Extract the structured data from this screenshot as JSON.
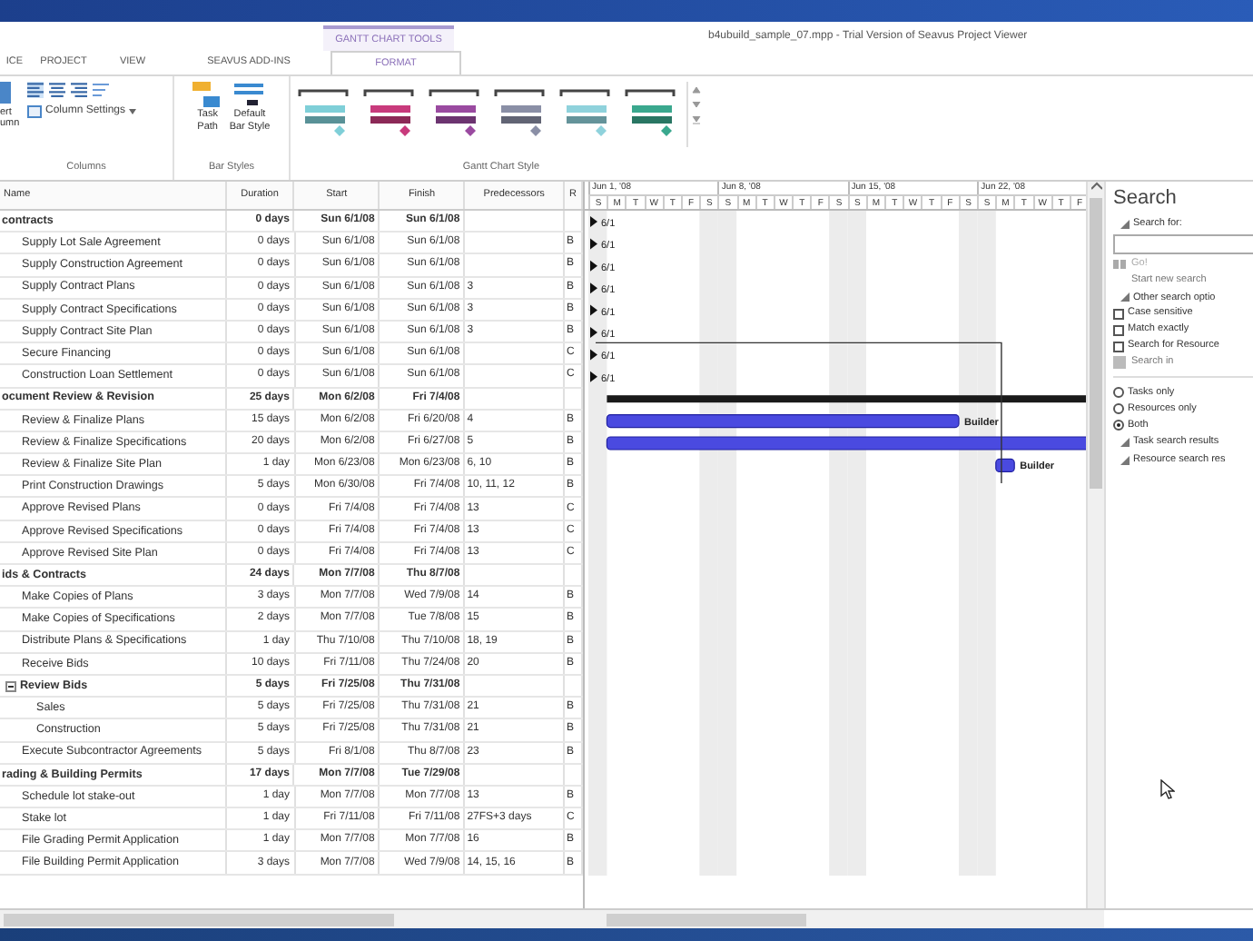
{
  "window": {
    "title": "b4ubuild_sample_07.mpp - Trial Version of Seavus Project Viewer",
    "tool_group": "GANTT CHART TOOLS"
  },
  "ribbon_tabs": [
    {
      "label": "ICE",
      "selected": false
    },
    {
      "label": "PROJECT",
      "selected": false
    },
    {
      "label": "VIEW",
      "selected": false
    },
    {
      "label": "SEAVUS ADD-INS",
      "selected": false
    },
    {
      "label": "FORMAT",
      "selected": true
    }
  ],
  "columns_group": {
    "title": "Columns",
    "insert_lines": [
      "ert",
      "umn"
    ],
    "settings": "Column Settings"
  },
  "bar_styles_group": {
    "title": "Bar Styles",
    "task_path": [
      "Task",
      "Path"
    ],
    "default_style": [
      "Default",
      "Bar Style"
    ]
  },
  "gantt_style_group": {
    "title": "Gantt Chart Style",
    "styles": [
      {
        "color": "#7fcfd8"
      },
      {
        "color": "#c83a7c"
      },
      {
        "color": "#9a4aa0"
      },
      {
        "color": "#8a8fa6"
      },
      {
        "color": "#8fd2dc"
      },
      {
        "color": "#3aa88e"
      }
    ]
  },
  "table": {
    "columns": [
      "Name",
      "Duration",
      "Start",
      "Finish",
      "Predecessors",
      "R"
    ],
    "tasks": [
      {
        "kind": "summary_milestone",
        "name": "contracts",
        "duration": "0 days",
        "start": "Sun 6/1/08",
        "finish": "Sun 6/1/08",
        "bar_label": "6/1",
        "children": [
          {
            "kind": "milestone",
            "name": "Supply Lot Sale Agreement",
            "duration": "0 days",
            "start": "Sun 6/1/08",
            "finish": "Sun 6/1/08",
            "resource": "B",
            "bar_label": "6/1"
          },
          {
            "kind": "milestone",
            "name": "Supply Construction Agreement",
            "duration": "0 days",
            "start": "Sun 6/1/08",
            "finish": "Sun 6/1/08",
            "resource": "B",
            "bar_label": "6/1"
          },
          {
            "kind": "milestone",
            "name": "Supply Contract Plans",
            "duration": "0 days",
            "start": "Sun 6/1/08",
            "finish": "Sun 6/1/08",
            "predecessors": "3",
            "resource": "B",
            "bar_label": "6/1"
          },
          {
            "kind": "milestone",
            "name": "Supply Contract Specifications",
            "duration": "0 days",
            "start": "Sun 6/1/08",
            "finish": "Sun 6/1/08",
            "predecessors": "3",
            "resource": "B",
            "bar_label": "6/1"
          },
          {
            "kind": "milestone",
            "name": "Supply Contract Site Plan",
            "duration": "0 days",
            "start": "Sun 6/1/08",
            "finish": "Sun 6/1/08",
            "predecessors": "3",
            "resource": "B",
            "bar_label": "6/1"
          },
          {
            "kind": "milestone",
            "name": "Secure Financing",
            "duration": "0 days",
            "start": "Sun 6/1/08",
            "finish": "Sun 6/1/08",
            "resource": "C",
            "bar_label": "6/1"
          },
          {
            "kind": "milestone",
            "name": "Construction Loan Settlement",
            "duration": "0 days",
            "start": "Sun 6/1/08",
            "finish": "Sun 6/1/08",
            "resource": "C",
            "bar_label": "6/1"
          }
        ]
      },
      {
        "kind": "summary",
        "name": "ocument Review & Revision",
        "duration": "25 days",
        "start": "Mon 6/2/08",
        "finish": "Fri 7/4/08",
        "children": [
          {
            "kind": "task",
            "name": "Review & Finalize Plans",
            "duration": "15 days",
            "start": "Mon 6/2/08",
            "finish": "Fri 6/20/08",
            "predecessors": "4",
            "resource": "B",
            "bar_label": "Builder"
          },
          {
            "kind": "task",
            "name": "Review & Finalize Specifications",
            "duration": "20 days",
            "start": "Mon 6/2/08",
            "finish": "Fri 6/27/08",
            "predecessors": "5",
            "resource": "B"
          },
          {
            "kind": "task",
            "name": "Review & Finalize Site Plan",
            "duration": "1 day",
            "start": "Mon 6/23/08",
            "finish": "Mon 6/23/08",
            "predecessors": "6, 10",
            "resource": "B",
            "bar_label": "Builder"
          },
          {
            "kind": "task",
            "name": "Print Construction Drawings",
            "duration": "5 days",
            "start": "Mon 6/30/08",
            "finish": "Fri 7/4/08",
            "predecessors": "10, 11, 12",
            "resource": "B"
          },
          {
            "kind": "milestone",
            "name": "Approve Revised Plans",
            "duration": "0 days",
            "start": "Fri 7/4/08",
            "finish": "Fri 7/4/08",
            "predecessors": "13",
            "resource": "C"
          },
          {
            "kind": "milestone",
            "name": "Approve Revised Specifications",
            "duration": "0 days",
            "start": "Fri 7/4/08",
            "finish": "Fri 7/4/08",
            "predecessors": "13",
            "resource": "C"
          },
          {
            "kind": "milestone",
            "name": "Approve Revised Site Plan",
            "duration": "0 days",
            "start": "Fri 7/4/08",
            "finish": "Fri 7/4/08",
            "predecessors": "13",
            "resource": "C"
          }
        ]
      },
      {
        "kind": "summary",
        "name": "ids & Contracts",
        "duration": "24 days",
        "start": "Mon 7/7/08",
        "finish": "Thu 8/7/08",
        "children": [
          {
            "kind": "task",
            "name": "Make Copies of Plans",
            "duration": "3 days",
            "start": "Mon 7/7/08",
            "finish": "Wed 7/9/08",
            "predecessors": "14",
            "resource": "B"
          },
          {
            "kind": "task",
            "name": "Make Copies of Specifications",
            "duration": "2 days",
            "start": "Mon 7/7/08",
            "finish": "Tue 7/8/08",
            "predecessors": "15",
            "resource": "B"
          },
          {
            "kind": "task",
            "name": "Distribute Plans & Specifications",
            "duration": "1 day",
            "start": "Thu 7/10/08",
            "finish": "Thu 7/10/08",
            "predecessors": "18, 19",
            "resource": "B"
          },
          {
            "kind": "task",
            "name": "Receive Bids",
            "duration": "10 days",
            "start": "Fri 7/11/08",
            "finish": "Thu 7/24/08",
            "predecessors": "20",
            "resource": "B"
          },
          {
            "kind": "summary",
            "name": "Review Bids",
            "duration": "5 days",
            "start": "Fri 7/25/08",
            "finish": "Thu 7/31/08",
            "expanded": true,
            "children": [
              {
                "name": "Sales",
                "duration": "5 days",
                "start": "Fri 7/25/08",
                "finish": "Thu 7/31/08",
                "predecessors": "21",
                "resource": "B"
              },
              {
                "name": "Construction",
                "duration": "5 days",
                "start": "Fri 7/25/08",
                "finish": "Thu 7/31/08",
                "predecessors": "21",
                "resource": "B"
              }
            ]
          },
          {
            "kind": "task",
            "name": "Execute Subcontractor Agreements",
            "duration": "5 days",
            "start": "Fri 8/1/08",
            "finish": "Thu 8/7/08",
            "predecessors": "23",
            "resource": "B"
          }
        ]
      },
      {
        "kind": "summary",
        "name": "rading & Building Permits",
        "duration": "17 days",
        "start": "Mon 7/7/08",
        "finish": "Tue 7/29/08",
        "children": [
          {
            "kind": "task",
            "name": "Schedule lot stake-out",
            "duration": "1 day",
            "start": "Mon 7/7/08",
            "finish": "Mon 7/7/08",
            "predecessors": "13",
            "resource": "B"
          },
          {
            "kind": "task",
            "name": "Stake lot",
            "duration": "1 day",
            "start": "Fri 7/11/08",
            "finish": "Fri 7/11/08",
            "predecessors": "27FS+3 days",
            "resource": "C"
          },
          {
            "kind": "task",
            "name": "File Grading Permit Application",
            "duration": "1 day",
            "start": "Mon 7/7/08",
            "finish": "Mon 7/7/08",
            "predecessors": "16",
            "resource": "B"
          },
          {
            "kind": "task",
            "name": "File Building Permit Application",
            "duration": "3 days",
            "start": "Mon 7/7/08",
            "finish": "Wed 7/9/08",
            "predecessors": "14, 15, 16",
            "resource": "B"
          }
        ]
      }
    ]
  },
  "gantt": {
    "weeks": [
      {
        "label": "Jun 1, '08",
        "days": [
          "S",
          "M",
          "T",
          "W",
          "T",
          "F",
          "S"
        ]
      },
      {
        "label": "Jun 8, '08",
        "days": [
          "S",
          "M",
          "T",
          "W",
          "T",
          "F",
          "S"
        ]
      },
      {
        "label": "Jun 15, '08",
        "days": [
          "S",
          "M",
          "T",
          "W",
          "T",
          "F",
          "S"
        ]
      },
      {
        "label": "Jun 22, '08",
        "days": [
          "S",
          "M",
          "T",
          "W",
          "T",
          "F"
        ]
      }
    ]
  },
  "search_pane": {
    "title": "Search",
    "search_for": "Search for:",
    "go": "Go!",
    "start_new": "Start new search",
    "other_options": "Other search optio",
    "options": [
      {
        "label": "Case sensitive",
        "checked": false
      },
      {
        "label": "Match exactly",
        "checked": false
      },
      {
        "label": "Search for Resource",
        "checked": false
      }
    ],
    "search_in": "Search in",
    "scope": [
      {
        "label": "Tasks only",
        "selected": false
      },
      {
        "label": "Resources only",
        "selected": false
      },
      {
        "label": "Both",
        "selected": true
      }
    ],
    "results": [
      "Task search results",
      "Resource search res"
    ]
  }
}
